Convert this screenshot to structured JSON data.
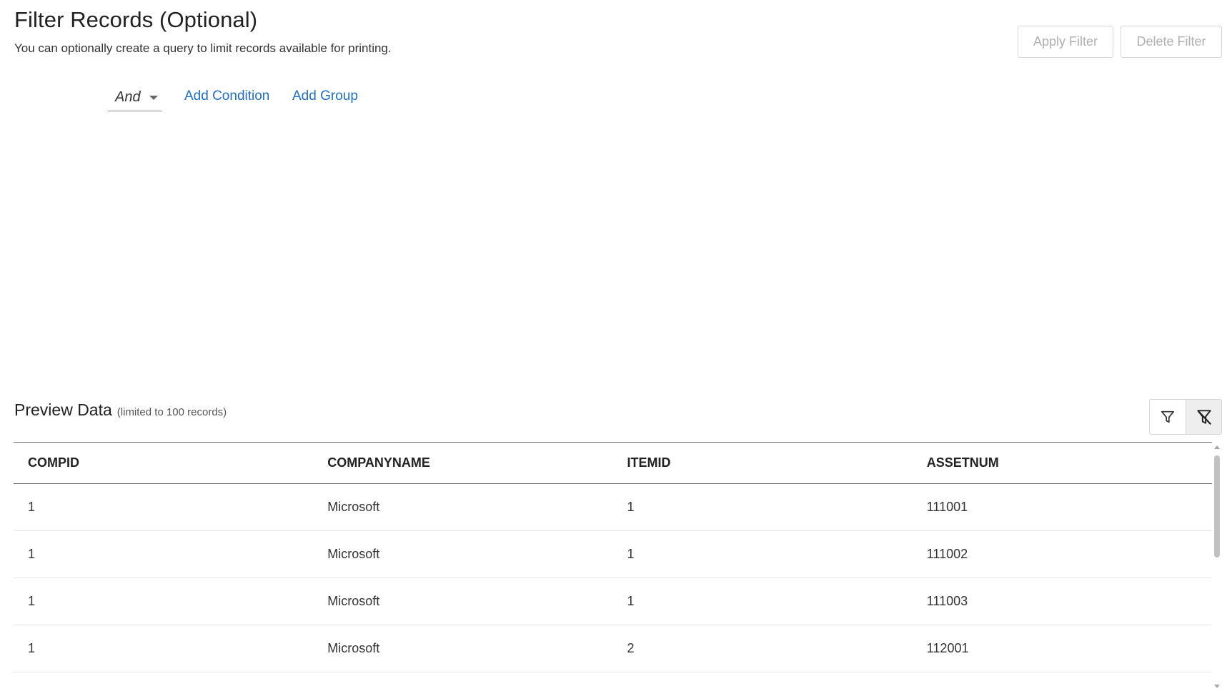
{
  "header": {
    "title": "Filter Records (Optional)",
    "subtitle": "You can optionally create a query to limit records available for printing."
  },
  "actions": {
    "apply_label": "Apply Filter",
    "delete_label": "Delete Filter"
  },
  "query_builder": {
    "logic_operator": "And",
    "add_condition_label": "Add Condition",
    "add_group_label": "Add Group"
  },
  "preview": {
    "title": "Preview Data",
    "note": "(limited to 100 records)",
    "icons": [
      "filter-icon",
      "clear-filter-icon"
    ],
    "columns": [
      "COMPID",
      "COMPANYNAME",
      "ITEMID",
      "ASSETNUM"
    ],
    "rows": [
      [
        "1",
        "Microsoft",
        "1",
        "111001"
      ],
      [
        "1",
        "Microsoft",
        "1",
        "111002"
      ],
      [
        "1",
        "Microsoft",
        "1",
        "111003"
      ],
      [
        "1",
        "Microsoft",
        "2",
        "112001"
      ]
    ]
  },
  "colors": {
    "link": "#1f6fc2",
    "disabled_text": "#b0b0b0",
    "border": "#d6d6d6"
  }
}
